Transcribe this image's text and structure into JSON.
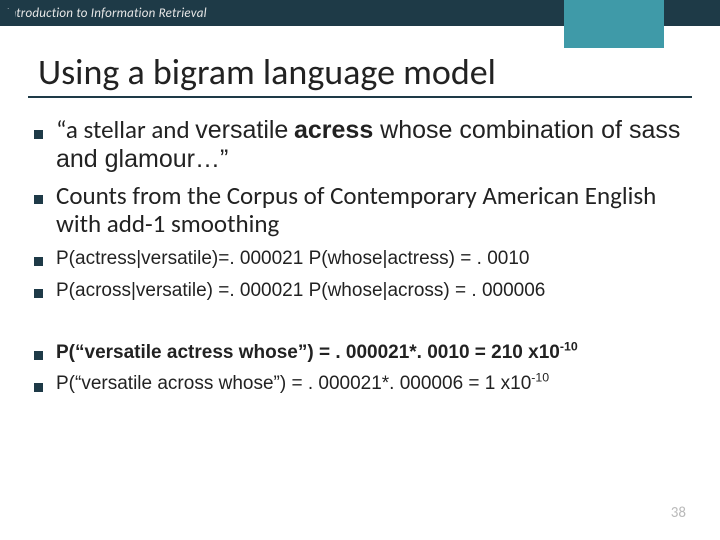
{
  "header": {
    "course": "Introduction to Information Retrieval"
  },
  "title": "Using a bigram language model",
  "bullets": {
    "quote_pre": "“a stellar and ",
    "quote_versatile": "versatile",
    "quote_mid1": " ",
    "quote_acress": "acress",
    "quote_mid2": " whose ",
    "quote_post": "combination of sass and glamour…”",
    "corpus": "Counts from the Corpus of Contemporary American English with add-1 smoothing",
    "p1": "P(actress|versatile)=. 000021 P(whose|actress) = . 0010",
    "p2": "P(across|versatile) =. 000021 P(whose|across) = . 000006",
    "r1_a": "P(“versatile actress whose”) = . 000021*. 0010 = 210 x10",
    "r1_exp": "-10",
    "r2_a": "P(“versatile across whose”)  = . 000021*. 000006 = 1 x10",
    "r2_exp": "-10"
  },
  "page": "38"
}
